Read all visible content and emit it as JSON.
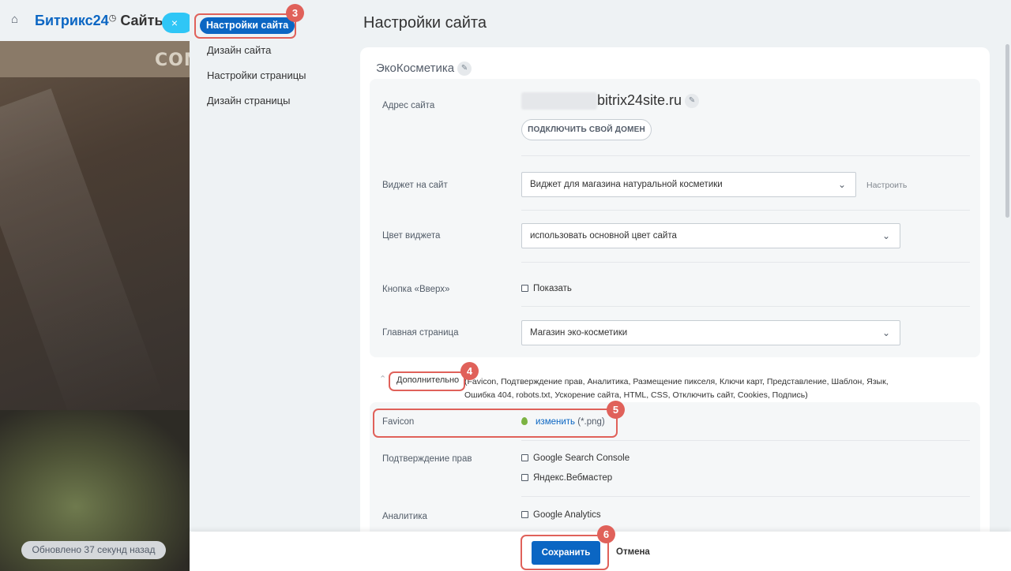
{
  "background": {
    "brand_prefix": "Битрикс",
    "brand_num": "24",
    "brand_suffix": "Сайты",
    "strip_text": "COM",
    "updated": "Обновлено 37 секунд назад",
    "close_label": "×"
  },
  "sidemenu": {
    "items": [
      {
        "label": "Настройки сайта"
      },
      {
        "label": "Дизайн сайта"
      },
      {
        "label": "Настройки страницы"
      },
      {
        "label": "Дизайн страницы"
      }
    ]
  },
  "main": {
    "title": "Настройки сайта",
    "site_name": "ЭкоКосметика",
    "address_label": "Адрес сайта",
    "domain": "bitrix24site.ru",
    "connect_domain": "ПОДКЛЮЧИТЬ СВОЙ ДОМЕН",
    "widget_label": "Виджет на сайт",
    "widget_value": "Виджет для магазина натуральной косметики",
    "widget_configure": "Настроить",
    "widget_color_label": "Цвет виджета",
    "widget_color_value": "использовать основной цвет сайта",
    "up_button_label": "Кнопка «Вверх»",
    "up_button_check": "Показать",
    "home_page_label": "Главная страница",
    "home_page_value": "Магазин эко-косметики",
    "extra_title": "Дополнительно",
    "extra_list_line1": "(Favicon, Подтверждение прав, Аналитика, Размещение пикселя, Ключи карт, Представление, Шаблон, Язык,",
    "extra_list_line2": "Ошибка 404, robots.txt, Ускорение сайта, HTML, CSS, Отключить сайт, Cookies, Подпись)",
    "favicon_label": "Favicon",
    "favicon_change": "изменить",
    "favicon_hint": "(*.png)",
    "rights_label": "Подтверждение прав",
    "rights_google": "Google Search Console",
    "rights_yandex": "Яндекс.Вебмастер",
    "analytics_label": "Аналитика",
    "analytics_google": "Google Analytics"
  },
  "badges": {
    "b3": "3",
    "b4": "4",
    "b5": "5",
    "b6": "6"
  },
  "bottom": {
    "save": "Сохранить",
    "cancel": "Отмена"
  },
  "colors": {
    "accent": "#0b66c3",
    "highlight": "#e0615a",
    "cyan": "#2fc6f6"
  },
  "icons": {
    "home": "home-icon",
    "pencil": "pencil-icon",
    "chevron": "chevron-down-icon",
    "favicon": "favicon-leaf-icon"
  }
}
